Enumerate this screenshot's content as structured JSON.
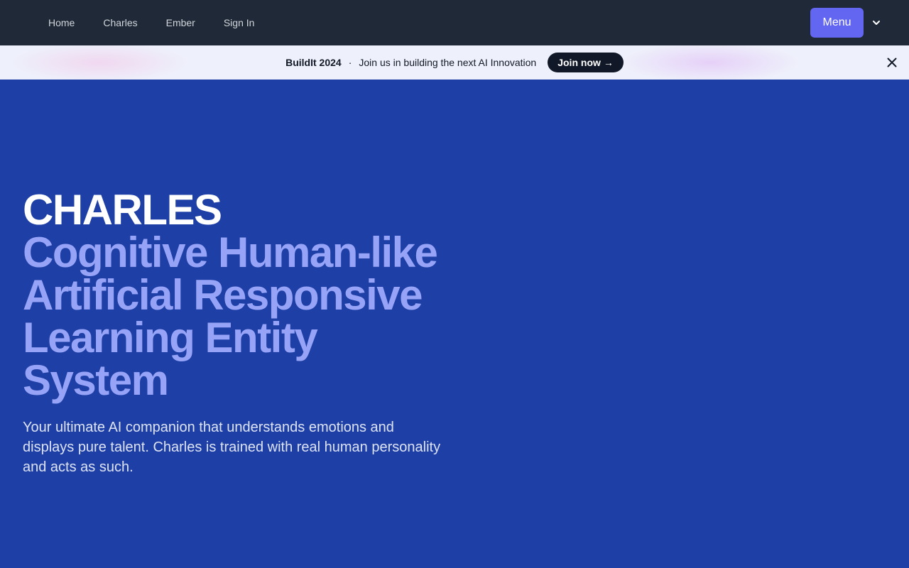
{
  "nav": {
    "links": [
      "Home",
      "Charles",
      "Ember",
      "Sign In"
    ],
    "menu_label": "Menu"
  },
  "banner": {
    "event": "BuildIt 2024",
    "separator": "·",
    "message": "Join us in building the next AI Innovation",
    "cta_label": "Join now",
    "cta_arrow": "→"
  },
  "hero": {
    "title": "CHARLES",
    "subtitle": "Cognitive Human-like Artificial Responsive Learning Entity System",
    "description": "Your ultimate AI companion that understands emotions and displays pure talent. Charles is trained with real human personality and acts as such."
  },
  "colors": {
    "navbar_bg": "#1f2937",
    "hero_bg": "#1e40a6",
    "accent": "#6366f1",
    "subtitle": "#97a3f7"
  },
  "icons": {
    "menu_toggle": "chevron-down-icon",
    "banner_close": "close-icon"
  }
}
